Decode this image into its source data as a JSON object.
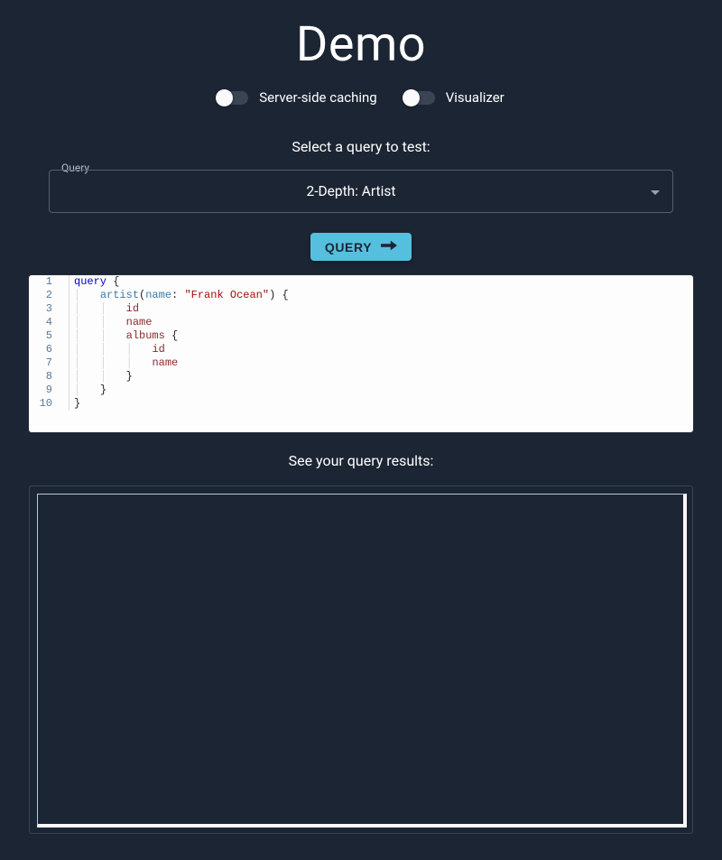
{
  "colors": {
    "bg": "#1c2533",
    "accent": "#56bfdf"
  },
  "title": "Demo",
  "toggles": {
    "serverCaching": {
      "label": "Server-side caching",
      "on": false
    },
    "visualizer": {
      "label": "Visualizer",
      "on": false
    }
  },
  "querySelect": {
    "prompt": "Select a query to test:",
    "fieldLabel": "Query",
    "selected": "2-Depth: Artist"
  },
  "queryButton": {
    "label": "QUERY"
  },
  "editor": {
    "lines": [
      {
        "n": "1",
        "indent": "",
        "tokens": [
          [
            "kw",
            "query"
          ],
          [
            "punct",
            " {"
          ]
        ]
      },
      {
        "n": "2",
        "indent": "    ",
        "tokens": [
          [
            "fn",
            "artist"
          ],
          [
            "punct",
            "("
          ],
          [
            "arg",
            "name"
          ],
          [
            "punct",
            ": "
          ],
          [
            "str",
            "\"Frank Ocean\""
          ],
          [
            "punct",
            ") {"
          ]
        ]
      },
      {
        "n": "3",
        "indent": "        ",
        "tokens": [
          [
            "field",
            "id"
          ]
        ]
      },
      {
        "n": "4",
        "indent": "        ",
        "tokens": [
          [
            "field",
            "name"
          ]
        ]
      },
      {
        "n": "5",
        "indent": "        ",
        "tokens": [
          [
            "field",
            "albums"
          ],
          [
            "punct",
            " {"
          ]
        ]
      },
      {
        "n": "6",
        "indent": "            ",
        "tokens": [
          [
            "field",
            "id"
          ]
        ]
      },
      {
        "n": "7",
        "indent": "            ",
        "tokens": [
          [
            "field",
            "name"
          ]
        ]
      },
      {
        "n": "8",
        "indent": "        ",
        "tokens": [
          [
            "punct",
            "}"
          ]
        ]
      },
      {
        "n": "9",
        "indent": "    ",
        "tokens": [
          [
            "punct",
            "}"
          ]
        ]
      },
      {
        "n": "10",
        "indent": "",
        "tokens": [
          [
            "punct",
            "}"
          ]
        ]
      }
    ]
  },
  "results": {
    "heading": "See your query results:"
  }
}
